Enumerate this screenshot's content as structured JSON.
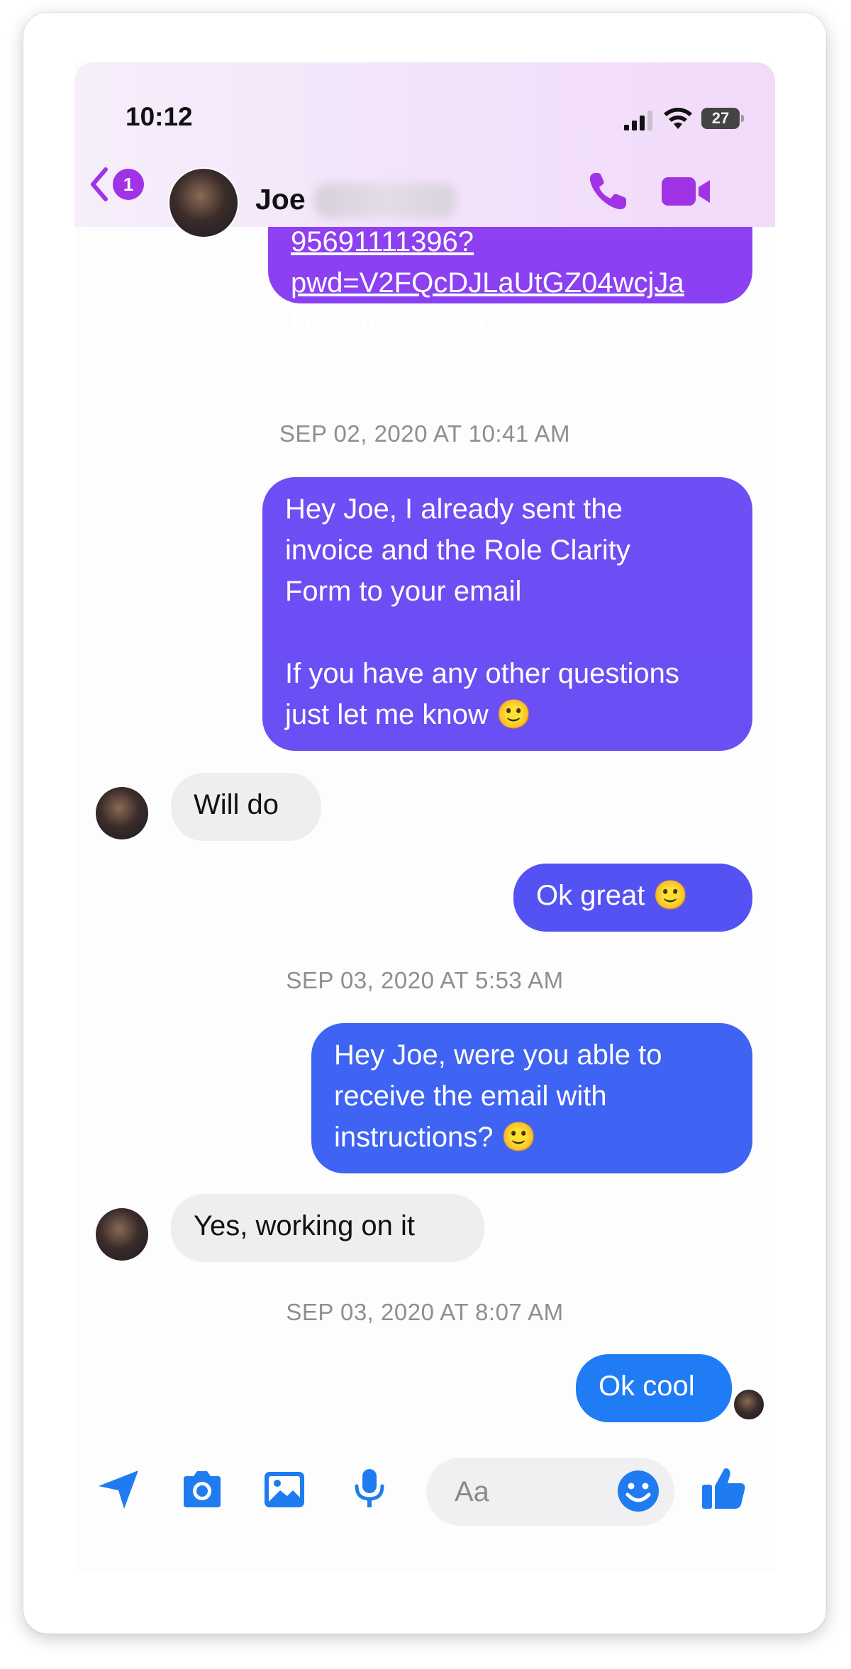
{
  "status_bar": {
    "time": "10:12",
    "battery": "27"
  },
  "header": {
    "back_badge": "1",
    "contact_name": "Joe"
  },
  "messages": {
    "link_message": "95691111396?\npwd=V2FQcDJLaUtGZ04wcjJa\nU2lPdEdYZz09",
    "ts1": "SEP 02, 2020 AT 10:41 AM",
    "msg_invoice": "Hey Joe, I already sent the\ninvoice and the Role Clarity\nForm to your email\n\nIf you have any other questions\njust let me know 🙂",
    "msg_will_do": "Will  do",
    "msg_ok_great": "Ok great 🙂",
    "ts2": "SEP 03, 2020 AT 5:53 AM",
    "msg_instructions": "Hey Joe, were you able to\nreceive the email with\ninstructions? 🙂",
    "msg_working": "Yes, working  on  it",
    "ts3": "SEP 03, 2020 AT 8:07 AM",
    "msg_ok_cool": "Ok cool"
  },
  "composer": {
    "placeholder": "Aa"
  },
  "colors": {
    "accent_purple": "#a033e6",
    "bubble_purple": "#8f3ff2",
    "bubble_violet": "#6f4cf5",
    "bubble_indigo": "#5552f3",
    "bubble_blue": "#3b64f2",
    "bubble_blue_bright": "#1f7cf5",
    "toolbar_blue": "#1e7cf0",
    "incoming_gray": "#eeeeef"
  }
}
